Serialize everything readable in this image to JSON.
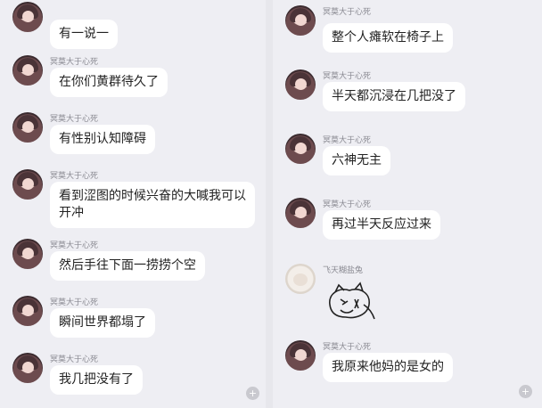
{
  "left_panel": {
    "messages": [
      {
        "name": "",
        "text": "有一说一"
      },
      {
        "name": "冥莫大于心死",
        "text": "在你们黄群待久了"
      },
      {
        "name": "冥莫大于心死",
        "text": "有性别认知障碍"
      },
      {
        "name": "冥莫大于心死",
        "text": "看到涩图的时候兴奋的大喊我可以开冲"
      },
      {
        "name": "冥莫大于心死",
        "text": "然后手往下面一捞捞个空"
      },
      {
        "name": "冥莫大于心死",
        "text": "瞬间世界都塌了"
      },
      {
        "name": "冥莫大于心死",
        "text": "我几把没有了"
      }
    ]
  },
  "right_panel": {
    "messages": [
      {
        "name": "冥莫大于心死",
        "text": "整个人瘫软在椅子上"
      },
      {
        "name": "冥莫大于心死",
        "text": "半天都沉浸在几把没了"
      },
      {
        "name": "冥莫大于心死",
        "text": "六神无主"
      },
      {
        "name": "冥莫大于心死",
        "text": "再过半天反应过来"
      },
      {
        "name": "飞天糊盐兔",
        "sticker": "crying-cat-sticker"
      },
      {
        "name": "冥莫大于心死",
        "text": "我原来他妈的是女的"
      }
    ]
  },
  "icons": {
    "zoom": "zoom-in-icon"
  },
  "colors": {
    "bubble": "#ffffff",
    "panel": "#eeeef3",
    "name": "#8a8a92"
  }
}
